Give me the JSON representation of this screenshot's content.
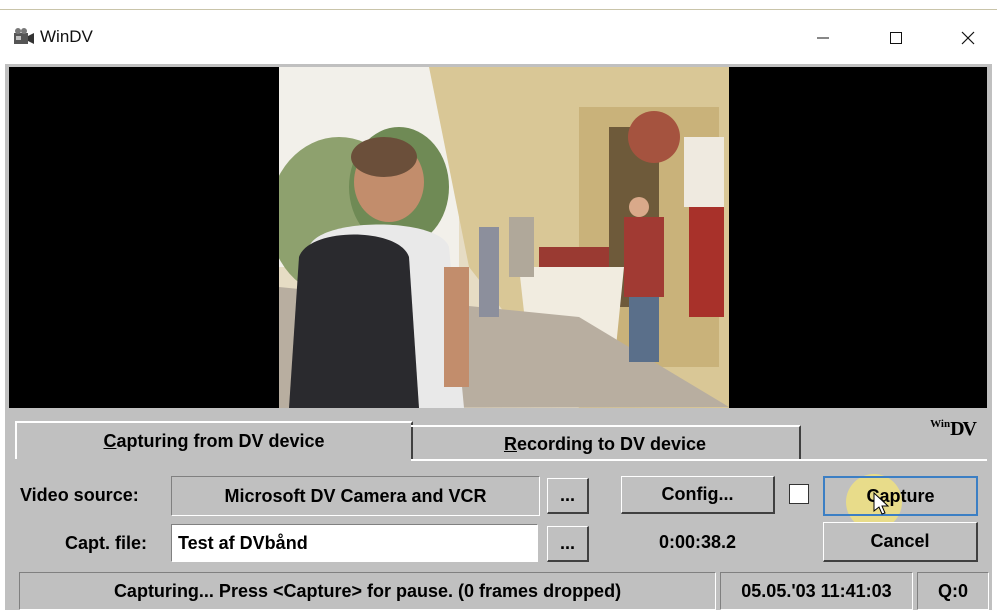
{
  "window": {
    "title": "WinDV",
    "icons": {
      "app": "video-camera-icon",
      "minimize": "minimize-icon",
      "maximize": "maximize-icon",
      "close": "close-icon"
    }
  },
  "logo": {
    "win": "Win",
    "dv": "DV"
  },
  "tabs": [
    {
      "label": "Capturing from DV device",
      "accel": "C",
      "rest": "apturing from DV device",
      "active": true
    },
    {
      "label": "Recording to DV device",
      "accel": "R",
      "rest": "ecording to DV device",
      "active": false
    }
  ],
  "form": {
    "video_source_label": "Video source:",
    "video_source_value": "Microsoft DV Camera and VCR",
    "browse_label": "...",
    "config_label": "Config...",
    "capture_label": "Capture",
    "capt_file_label": "Capt. file:",
    "capt_file_value": "Test af DVbånd",
    "browse2_label": "...",
    "elapsed_time": "0:00:38.2",
    "cancel_label": "Cancel",
    "checkbox_checked": false
  },
  "status": {
    "message": "Capturing...  Press <Capture> for pause. (0 frames dropped)",
    "datetime": "05.05.'03 11:41:03",
    "queue": "Q:0"
  },
  "colors": {
    "face": "#c0c0c0",
    "focus": "#3c7fc4",
    "cursor_highlight": "#f5e678"
  }
}
